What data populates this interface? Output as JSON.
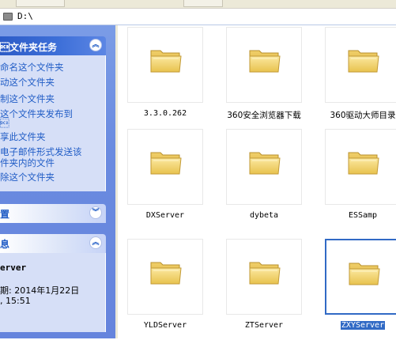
{
  "address": {
    "path": "D:\\"
  },
  "task_panel": {
    "title": "\u0013文件夹任务",
    "items": [
      {
        "label": "命名这个文件夹"
      },
      {
        "label": "动这个文件夹"
      },
      {
        "label": "制这个文件夹"
      },
      {
        "label": "这个文件夹发布到"
      },
      {
        "label": "\u0013"
      },
      {
        "label": "享此文件夹"
      },
      {
        "label": "电子邮件形式发送该"
      },
      {
        "label": "件夹内的文件"
      },
      {
        "label": "除这个文件夹"
      }
    ]
  },
  "places_panel": {
    "title": "置"
  },
  "details_panel": {
    "title": "息",
    "name": "erver",
    "modified": "期: 2014年1月22日",
    "time": ", 15:51"
  },
  "folders": [
    {
      "label": "3.3.0.262",
      "selected": false
    },
    {
      "label": "360安全浏览器下载",
      "selected": false
    },
    {
      "label": "360驱动大师目录",
      "selected": false
    },
    {
      "label": "DXServer",
      "selected": false
    },
    {
      "label": "dybeta",
      "selected": false
    },
    {
      "label": "ESSamp",
      "selected": false
    },
    {
      "label": "YLDServer",
      "selected": false
    },
    {
      "label": "ZTServer",
      "selected": false
    },
    {
      "label": "ZXYServer",
      "selected": true
    }
  ],
  "colors": {
    "link": "#215dc6",
    "pane": "#6a8be0",
    "panel_body": "#d6dff7",
    "selection": "#316ac5",
    "folder": "#f3d66b"
  }
}
